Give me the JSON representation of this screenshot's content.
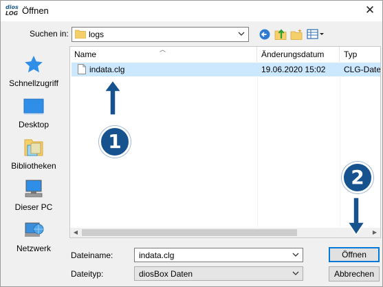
{
  "window": {
    "title": "Öffnen",
    "app_icon_line1": "dios",
    "app_icon_line2": "LOG",
    "close_glyph": "✕"
  },
  "lookin": {
    "label": "Suchen in:",
    "value": "logs"
  },
  "places": [
    {
      "label": "Schnellzugriff",
      "icon": "star-icon"
    },
    {
      "label": "Desktop",
      "icon": "desktop-icon"
    },
    {
      "label": "Bibliotheken",
      "icon": "library-icon"
    },
    {
      "label": "Dieser PC",
      "icon": "computer-icon"
    },
    {
      "label": "Netzwerk",
      "icon": "network-icon"
    }
  ],
  "columns": {
    "name": "Name",
    "date": "Änderungsdatum",
    "type": "Typ"
  },
  "files": [
    {
      "name": "indata.clg",
      "date": "19.06.2020 15:02",
      "type": "CLG-Date"
    }
  ],
  "filename": {
    "label": "Dateiname:",
    "value": "indata.clg"
  },
  "filetype": {
    "label": "Dateityp:",
    "value": "diosBox Daten"
  },
  "buttons": {
    "open": "Öffnen",
    "cancel": "Abbrechen"
  },
  "annotations": {
    "badge1": "1",
    "badge2": "2"
  },
  "colors": {
    "selection": "#cce8ff",
    "annotation": "#16528e",
    "accent": "#0078d7"
  }
}
